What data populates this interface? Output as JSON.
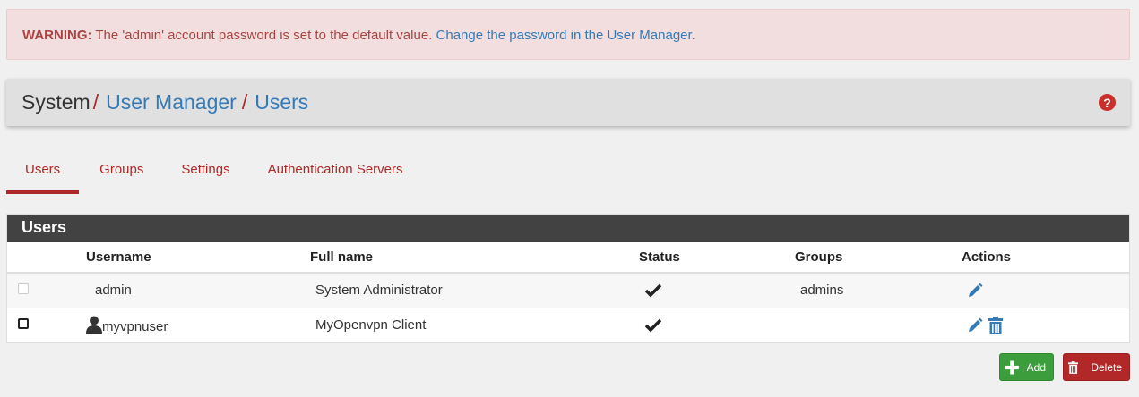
{
  "alert": {
    "prefix": "WARNING:",
    "text": " The 'admin' account password is set to the default value. ",
    "link": "Change the password in the User Manager."
  },
  "breadcrumb": {
    "root": "System",
    "sep": "/",
    "level1": "User Manager",
    "level2": "Users",
    "help_glyph": "?"
  },
  "tabs": [
    {
      "label": "Users",
      "active": true
    },
    {
      "label": "Groups"
    },
    {
      "label": "Settings"
    },
    {
      "label": "Authentication Servers"
    }
  ],
  "panel": {
    "title": "Users",
    "headers": {
      "username": "Username",
      "fullname": "Full name",
      "status": "Status",
      "groups": "Groups",
      "actions": "Actions"
    },
    "rows": [
      {
        "username": "admin",
        "fullname": "System Administrator",
        "status": "check-icon",
        "groups": "admins",
        "actions": [
          "edit-icon"
        ]
      },
      {
        "username": "myvpnuser",
        "fullname": "MyOpenvpn Client",
        "status": "check-icon",
        "groups": "",
        "actions": [
          "edit-icon",
          "trash-icon"
        ],
        "user_icon": "user-icon"
      }
    ]
  },
  "buttons": {
    "add": "Add",
    "delete": "Delete"
  },
  "colors": {
    "brand_red": "#ad2828",
    "link_blue": "#337ab7",
    "add_green": "#3c9d3c",
    "delete_red": "#b22828",
    "panel_header": "#424242"
  }
}
